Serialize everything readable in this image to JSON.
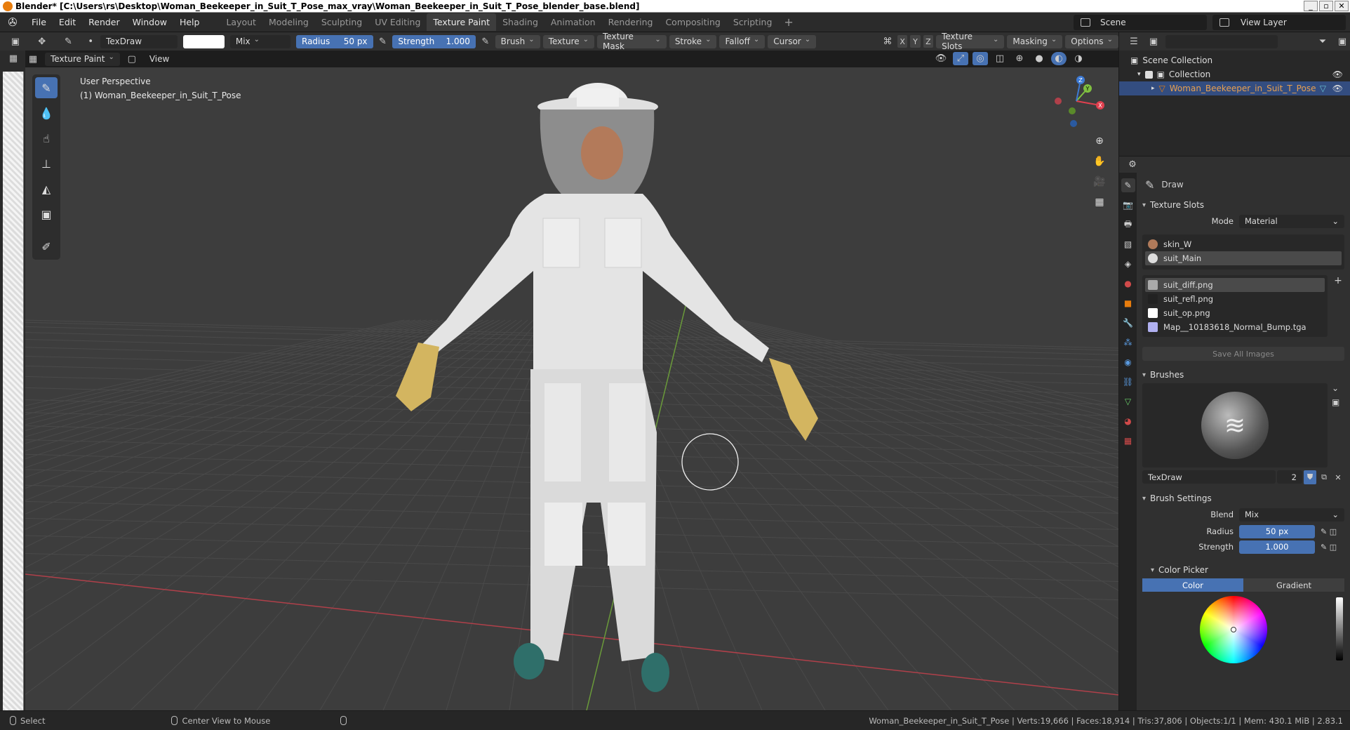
{
  "window": {
    "title": "Blender* [C:\\Users\\rs\\Desktop\\Woman_Beekeeper_in_Suit_T_Pose_max_vray\\Woman_Beekeeper_in_Suit_T_Pose_blender_base.blend]",
    "min": "_",
    "max": "▫",
    "close": "✕"
  },
  "menubar": {
    "menus": [
      "File",
      "Edit",
      "Render",
      "Window",
      "Help"
    ],
    "workspaces": [
      "Layout",
      "Modeling",
      "Sculpting",
      "UV Editing",
      "Texture Paint",
      "Shading",
      "Animation",
      "Rendering",
      "Compositing",
      "Scripting"
    ],
    "active_workspace": "Texture Paint",
    "add_tab": "+",
    "scene": "Scene",
    "view_layer": "View Layer"
  },
  "toolheader": {
    "brush_name": "TexDraw",
    "blend": "Mix",
    "radius_label": "Radius",
    "radius_value": "50 px",
    "strength_label": "Strength",
    "strength_value": "1.000",
    "menus": [
      "Brush",
      "Texture",
      "Texture Mask",
      "Stroke",
      "Falloff",
      "Cursor"
    ],
    "axes": [
      "X",
      "Y",
      "Z"
    ],
    "right_menus": [
      "Texture Slots",
      "Masking",
      "Options"
    ]
  },
  "viewheader": {
    "mode": "Texture Paint",
    "view": "View"
  },
  "viewport": {
    "perspective": "User Perspective",
    "object_label": "(1) Woman_Beekeeper_in_Suit_T_Pose",
    "gizmo": {
      "x": "X",
      "y": "Y",
      "z": "Z"
    }
  },
  "outliner": {
    "scene_collection": "Scene Collection",
    "collection": "Collection",
    "object": "Woman_Beekeeper_in_Suit_T_Pose"
  },
  "properties": {
    "tool_name": "Draw",
    "texture_slots": {
      "title": "Texture Slots",
      "mode_label": "Mode",
      "mode_value": "Material",
      "materials": [
        "skin_W",
        "suit_Main"
      ],
      "images": [
        "suit_diff.png",
        "suit_refl.png",
        "suit_op.png",
        "Map__10183618_Normal_Bump.tga"
      ],
      "save_all": "Save All Images"
    },
    "brushes": {
      "title": "Brushes",
      "brush_name": "TexDraw",
      "users": "2"
    },
    "brush_settings": {
      "title": "Brush Settings",
      "blend_label": "Blend",
      "blend_value": "Mix",
      "radius_label": "Radius",
      "radius_value": "50 px",
      "strength_label": "Strength",
      "strength_value": "1.000"
    },
    "color_picker": {
      "title": "Color Picker",
      "color_tab": "Color",
      "gradient_tab": "Gradient"
    }
  },
  "statusbar": {
    "select": "Select",
    "center_view": "Center View to Mouse",
    "stats": "Woman_Beekeeper_in_Suit_T_Pose | Verts:19,666 | Faces:18,914 | Tris:37,806 | Objects:1/1 | Mem: 430.1 MiB | 2.83.1"
  },
  "colors": {
    "accent": "#4772b3",
    "orange": "#e87d0d",
    "viewport_bg": "#3d3d3d",
    "x_axis": "#e0404f",
    "y_axis": "#80c040",
    "z_axis": "#3d7ad4"
  }
}
